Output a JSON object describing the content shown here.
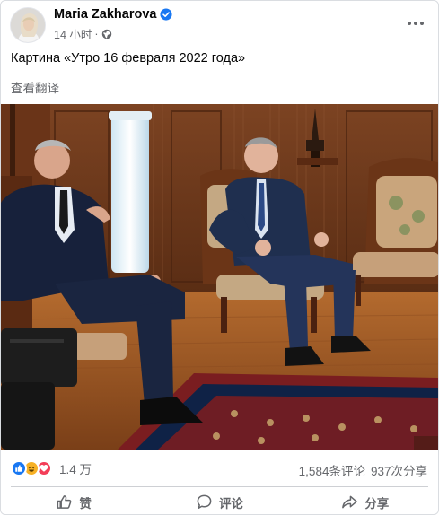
{
  "post": {
    "author": "Maria Zakharova",
    "time": "14 小时",
    "separator": "·",
    "text": "Картина «Утро 16 февраля 2022 года»",
    "translate_label": "查看翻译"
  },
  "stats": {
    "reactions_count": "1.4 万",
    "comments": "1,584条评论",
    "shares": "937次分享"
  },
  "actions": {
    "like": "赞",
    "comment": "评论",
    "share": "分享"
  },
  "colors": {
    "brand_blue": "#1877f2",
    "secondary_text": "#65676b",
    "divider": "#ced0d4"
  },
  "icons": {
    "verified": "verified-badge-icon",
    "privacy": "globe-icon",
    "more": "more-options-icon",
    "like": "thumbs-up-icon",
    "comment": "comment-bubble-icon",
    "share": "share-arrow-icon"
  }
}
